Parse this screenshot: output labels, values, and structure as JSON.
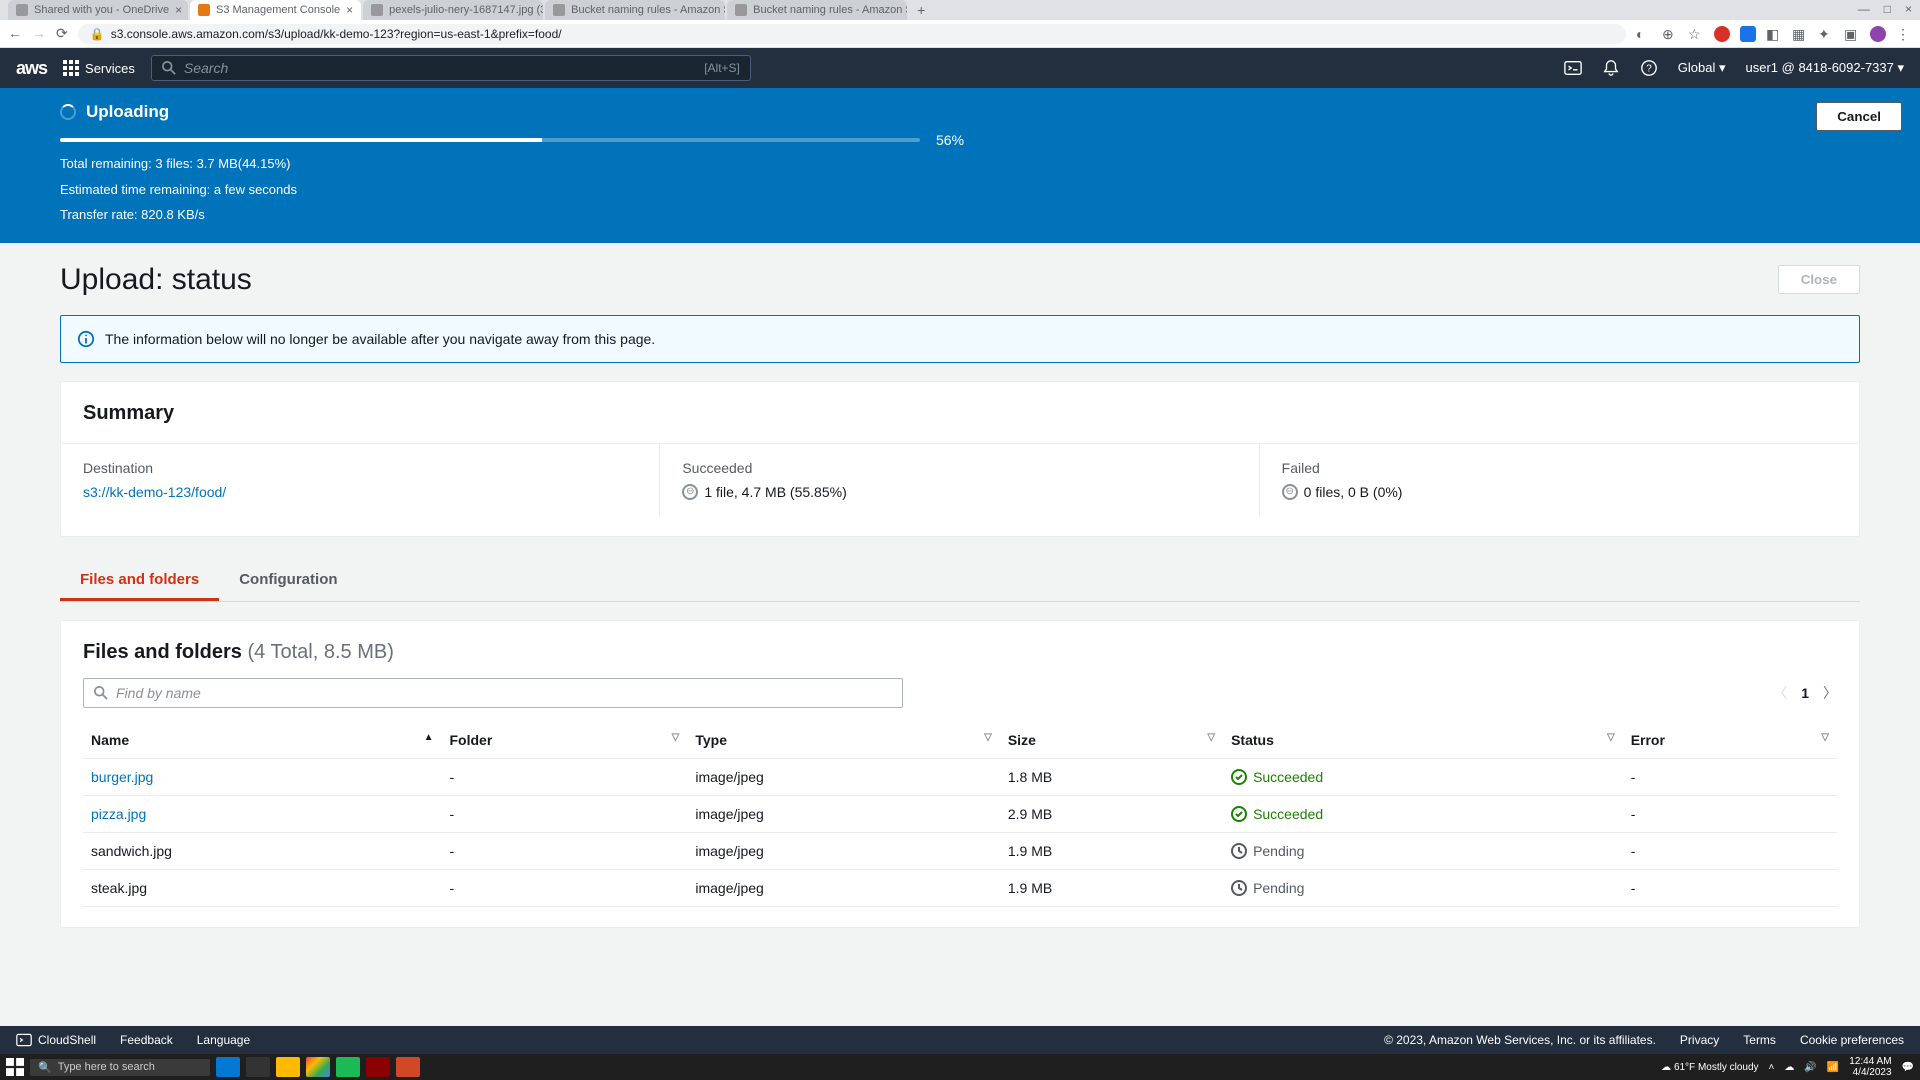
{
  "browser": {
    "tabs": [
      {
        "title": "Shared with you - OneDrive"
      },
      {
        "title": "S3 Management Console"
      },
      {
        "title": "pexels-julio-nery-1687147.jpg (3..."
      },
      {
        "title": "Bucket naming rules - Amazon S..."
      },
      {
        "title": "Bucket naming rules - Amazon S..."
      }
    ],
    "url": "s3.console.aws.amazon.com/s3/upload/kk-demo-123?region=us-east-1&prefix=food/"
  },
  "nav": {
    "services": "Services",
    "search_placeholder": "Search",
    "search_hint": "[Alt+S]",
    "region": "Global",
    "user": "user1 @ 8418-6092-7337"
  },
  "banner": {
    "title": "Uploading",
    "percent": "56%",
    "percent_val": 56,
    "remaining": "Total remaining: 3 files: 3.7 MB(44.15%)",
    "eta": "Estimated time remaining: a few seconds",
    "rate": "Transfer rate: 820.8 KB/s",
    "cancel": "Cancel"
  },
  "page": {
    "title": "Upload: status",
    "close": "Close",
    "info": "The information below will no longer be available after you navigate away from this page."
  },
  "summary": {
    "heading": "Summary",
    "destination_label": "Destination",
    "destination_val": "s3://kk-demo-123/food/",
    "succeeded_label": "Succeeded",
    "succeeded_val": "1 file, 4.7 MB (55.85%)",
    "failed_label": "Failed",
    "failed_val": "0 files, 0 B (0%)"
  },
  "tabs": {
    "files": "Files and folders",
    "config": "Configuration"
  },
  "files": {
    "heading": "Files and folders",
    "subhead": "(4 Total, 8.5 MB)",
    "filter_placeholder": "Find by name",
    "page": "1",
    "cols": {
      "name": "Name",
      "folder": "Folder",
      "type": "Type",
      "size": "Size",
      "status": "Status",
      "error": "Error"
    },
    "rows": [
      {
        "name": "burger.jpg",
        "folder": "-",
        "type": "image/jpeg",
        "size": "1.8 MB",
        "status": "Succeeded",
        "error": "-",
        "link": true
      },
      {
        "name": "pizza.jpg",
        "folder": "-",
        "type": "image/jpeg",
        "size": "2.9 MB",
        "status": "Succeeded",
        "error": "-",
        "link": true
      },
      {
        "name": "sandwich.jpg",
        "folder": "-",
        "type": "image/jpeg",
        "size": "1.9 MB",
        "status": "Pending",
        "error": "-",
        "link": false
      },
      {
        "name": "steak.jpg",
        "folder": "-",
        "type": "image/jpeg",
        "size": "1.9 MB",
        "status": "Pending",
        "error": "-",
        "link": false
      }
    ]
  },
  "footer": {
    "cloudshell": "CloudShell",
    "feedback": "Feedback",
    "language": "Language",
    "copyright": "© 2023, Amazon Web Services, Inc. or its affiliates.",
    "privacy": "Privacy",
    "terms": "Terms",
    "cookie": "Cookie preferences"
  },
  "taskbar": {
    "search": "Type here to search",
    "weather": "61°F  Mostly cloudy",
    "time": "12:44 AM",
    "date": "4/4/2023"
  }
}
